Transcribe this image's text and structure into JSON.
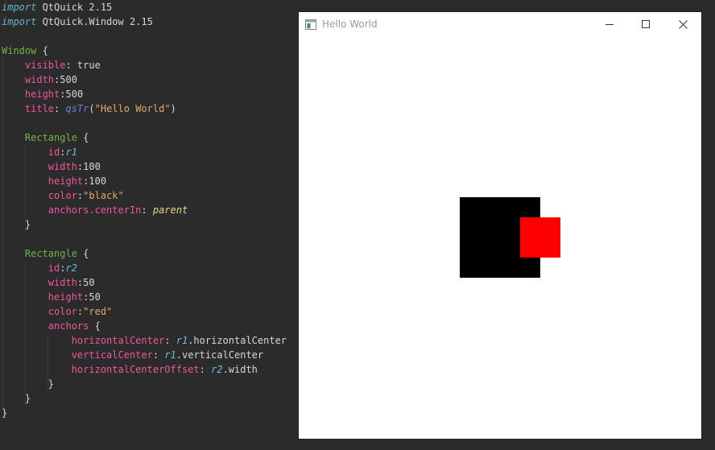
{
  "editor": {
    "lines": [
      [
        [
          "tok-kw-i",
          "import"
        ],
        [
          "tok-plain",
          " QtQuick 2.15"
        ]
      ],
      [
        [
          "tok-kw-i",
          "import"
        ],
        [
          "tok-plain",
          " QtQuick.Window 2.15"
        ]
      ],
      [],
      [
        [
          "tok-type",
          "Window"
        ],
        [
          "tok-plain",
          " {"
        ]
      ],
      [
        [
          "tok-plain",
          "    "
        ],
        [
          "tok-prop",
          "visible"
        ],
        [
          "tok-plain",
          ": true"
        ]
      ],
      [
        [
          "tok-plain",
          "    "
        ],
        [
          "tok-prop",
          "width"
        ],
        [
          "tok-plain",
          ":500"
        ]
      ],
      [
        [
          "tok-plain",
          "    "
        ],
        [
          "tok-prop",
          "height"
        ],
        [
          "tok-plain",
          ":500"
        ]
      ],
      [
        [
          "tok-plain",
          "    "
        ],
        [
          "tok-prop",
          "title"
        ],
        [
          "tok-plain",
          ": "
        ],
        [
          "tok-fn",
          "qsTr"
        ],
        [
          "tok-plain",
          "("
        ],
        [
          "tok-str",
          "\"Hello World\""
        ],
        [
          "tok-plain",
          ")"
        ]
      ],
      [],
      [
        [
          "tok-plain",
          "    "
        ],
        [
          "tok-type",
          "Rectangle"
        ],
        [
          "tok-plain",
          " {"
        ]
      ],
      [
        [
          "tok-plain",
          "        "
        ],
        [
          "tok-prop",
          "id"
        ],
        [
          "tok-plain",
          ":"
        ],
        [
          "tok-id",
          "r1"
        ]
      ],
      [
        [
          "tok-plain",
          "        "
        ],
        [
          "tok-prop",
          "width"
        ],
        [
          "tok-plain",
          ":100"
        ]
      ],
      [
        [
          "tok-plain",
          "        "
        ],
        [
          "tok-prop",
          "height"
        ],
        [
          "tok-plain",
          ":100"
        ]
      ],
      [
        [
          "tok-plain",
          "        "
        ],
        [
          "tok-prop",
          "color"
        ],
        [
          "tok-plain",
          ":"
        ],
        [
          "tok-str",
          "\"black\""
        ]
      ],
      [
        [
          "tok-plain",
          "        "
        ],
        [
          "tok-prop",
          "anchors.centerIn"
        ],
        [
          "tok-plain",
          ": "
        ],
        [
          "tok-par",
          "parent"
        ]
      ],
      [
        [
          "tok-plain",
          "    }"
        ]
      ],
      [],
      [
        [
          "tok-plain",
          "    "
        ],
        [
          "tok-type",
          "Rectangle"
        ],
        [
          "tok-plain",
          " {"
        ]
      ],
      [
        [
          "tok-plain",
          "        "
        ],
        [
          "tok-prop",
          "id"
        ],
        [
          "tok-plain",
          ":"
        ],
        [
          "tok-id",
          "r2"
        ]
      ],
      [
        [
          "tok-plain",
          "        "
        ],
        [
          "tok-prop",
          "width"
        ],
        [
          "tok-plain",
          ":50"
        ]
      ],
      [
        [
          "tok-plain",
          "        "
        ],
        [
          "tok-prop",
          "height"
        ],
        [
          "tok-plain",
          ":50"
        ]
      ],
      [
        [
          "tok-plain",
          "        "
        ],
        [
          "tok-prop",
          "color"
        ],
        [
          "tok-plain",
          ":"
        ],
        [
          "tok-str",
          "\"red\""
        ]
      ],
      [
        [
          "tok-plain",
          "        "
        ],
        [
          "tok-prop",
          "anchors"
        ],
        [
          "tok-plain",
          " {"
        ]
      ],
      [
        [
          "tok-plain",
          "            "
        ],
        [
          "tok-prop",
          "horizontalCenter"
        ],
        [
          "tok-plain",
          ": "
        ],
        [
          "tok-id",
          "r1"
        ],
        [
          "tok-plain",
          ".horizontalCenter"
        ]
      ],
      [
        [
          "tok-plain",
          "            "
        ],
        [
          "tok-prop",
          "verticalCenter"
        ],
        [
          "tok-plain",
          ": "
        ],
        [
          "tok-id",
          "r1"
        ],
        [
          "tok-plain",
          ".verticalCenter"
        ]
      ],
      [
        [
          "tok-plain",
          "            "
        ],
        [
          "tok-prop",
          "horizontalCenterOffset"
        ],
        [
          "tok-plain",
          ": "
        ],
        [
          "tok-id",
          "r2"
        ],
        [
          "tok-plain",
          ".width"
        ]
      ],
      [
        [
          "tok-plain",
          "        }"
        ]
      ],
      [
        [
          "tok-plain",
          "    }"
        ]
      ],
      [
        [
          "tok-plain",
          "}"
        ]
      ]
    ]
  },
  "window": {
    "title": "Hello World",
    "buttons": {
      "minimize": "minimize",
      "maximize": "maximize",
      "close": "close"
    }
  },
  "scene": {
    "rect_r1_color": "#000000",
    "rect_r2_color": "#ff0000"
  },
  "colors": {
    "editor_bg": "#2b2b2b",
    "keyword": "#5fb7d2",
    "type": "#70b542",
    "property": "#f0569e",
    "string": "#e3a86b",
    "function": "#5e83e6",
    "identifier": "#62c4d3"
  }
}
